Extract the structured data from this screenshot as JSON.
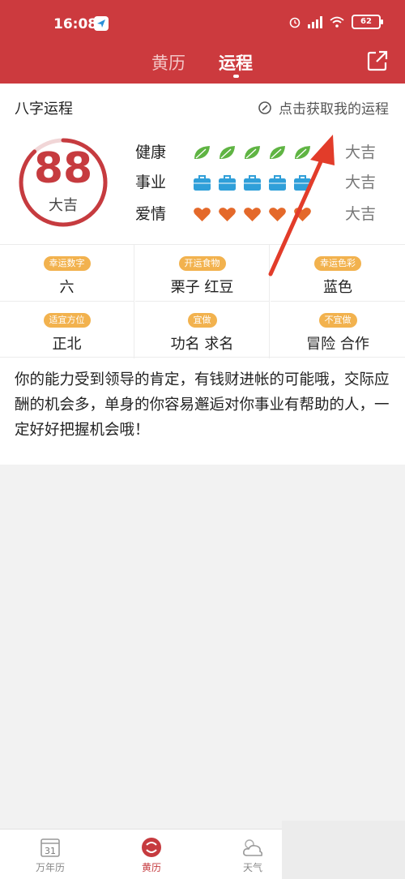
{
  "status_bar": {
    "time": "16:08",
    "battery": "62"
  },
  "tabs": [
    {
      "label": "黄历",
      "active": false
    },
    {
      "label": "运程",
      "active": true
    }
  ],
  "card": {
    "title": "八字运程",
    "get_fortune_label": "点击获取我的运程",
    "score": {
      "value": "88",
      "label": "大吉",
      "fraction": 0.88
    },
    "rows": [
      {
        "label": "健康",
        "icon": "leaf-icon",
        "count": 5,
        "level": "大吉",
        "color": "#5fb443"
      },
      {
        "label": "事业",
        "icon": "briefcase-icon",
        "count": 5,
        "level": "大吉",
        "color": "#2f9fd9"
      },
      {
        "label": "爱情",
        "icon": "heart-icon",
        "count": 5,
        "level": "大吉",
        "color": "#e4692a"
      }
    ],
    "grid": [
      {
        "tag": "幸运数字",
        "value": "六"
      },
      {
        "tag": "开运食物",
        "value": "栗子 红豆"
      },
      {
        "tag": "幸运色彩",
        "value": "蓝色"
      },
      {
        "tag": "适宜方位",
        "value": "正北"
      },
      {
        "tag": "宜做",
        "value": "功名 求名"
      },
      {
        "tag": "不宜做",
        "value": "冒险 合作"
      }
    ],
    "description": "你的能力受到领导的肯定，有钱财进帐的可能哦，交际应酬的机会多，单身的你容易邂逅对你事业有帮助的人，一定好好把握机会哦！"
  },
  "bottom_nav": [
    {
      "label": "万年历",
      "icon": "calendar-icon",
      "day": "31"
    },
    {
      "label": "黄历",
      "icon": "huangli-logo-icon"
    },
    {
      "label": "天气",
      "icon": "weather-icon"
    }
  ],
  "colors": {
    "brand_red": "#cc3a3e",
    "score_red": "#c63b3f",
    "badge_orange": "#f2b24e",
    "arrow_red": "#e23c2a"
  }
}
